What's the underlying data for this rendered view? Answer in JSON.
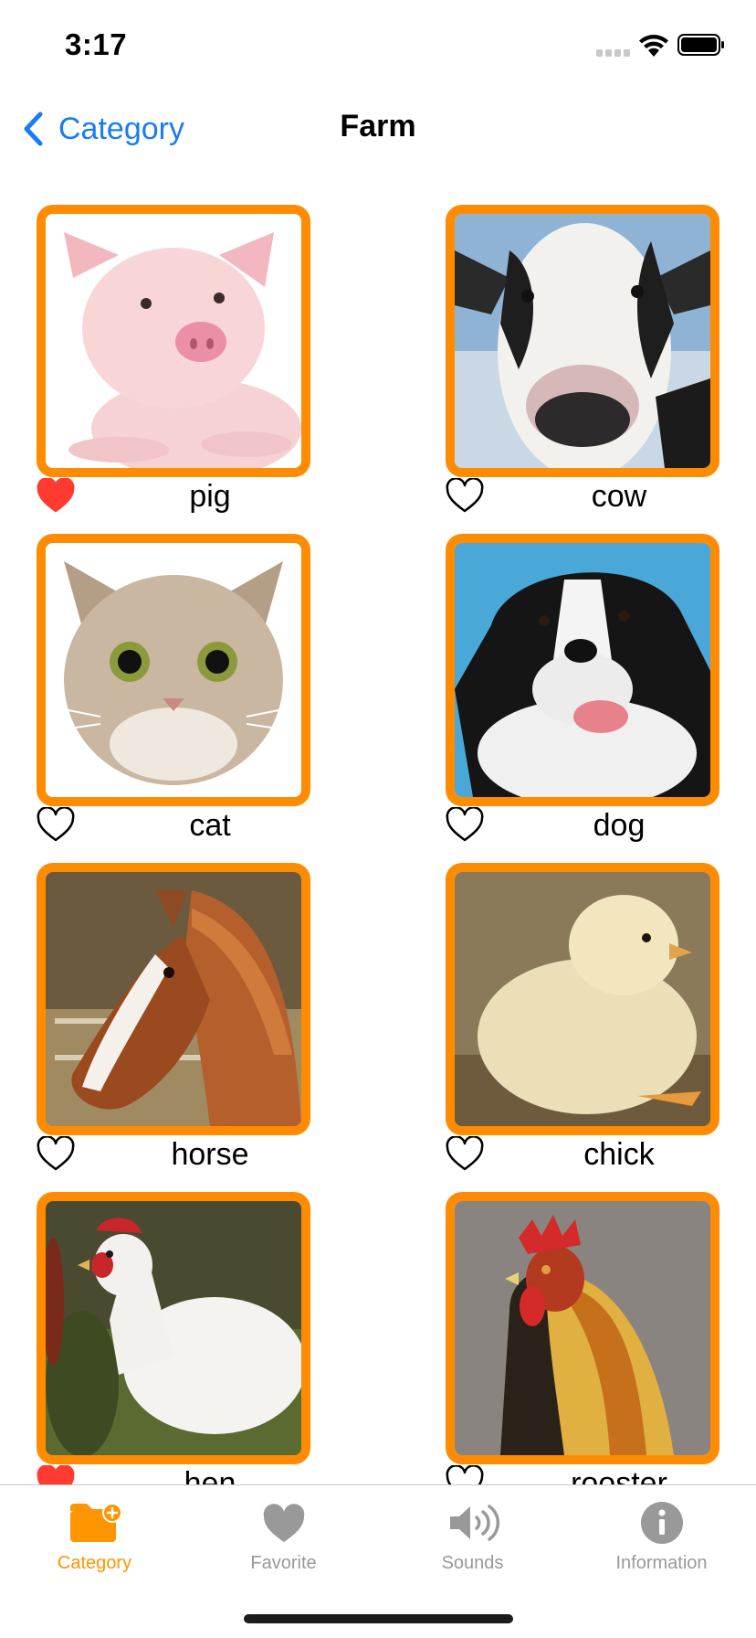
{
  "status_bar": {
    "time": "3:17"
  },
  "nav": {
    "back_label": "Category",
    "title": "Farm"
  },
  "animals": [
    {
      "name": "pig",
      "favorite": true
    },
    {
      "name": "cow",
      "favorite": false
    },
    {
      "name": "cat",
      "favorite": false
    },
    {
      "name": "dog",
      "favorite": false
    },
    {
      "name": "horse",
      "favorite": false
    },
    {
      "name": "chick",
      "favorite": false
    },
    {
      "name": "hen",
      "favorite": true
    },
    {
      "name": "rooster",
      "favorite": false
    }
  ],
  "tabs": [
    {
      "label": "Category",
      "icon": "folder-plus-icon",
      "active": true
    },
    {
      "label": "Favorite",
      "icon": "heart-icon",
      "active": false
    },
    {
      "label": "Sounds",
      "icon": "speaker-icon",
      "active": false
    },
    {
      "label": "Information",
      "icon": "info-icon",
      "active": false
    }
  ],
  "colors": {
    "accent": "#ff8c00",
    "tab_active": "#ff9500",
    "tab_inactive": "#999999",
    "link": "#1a7cf5",
    "favorite_heart": "#ff3b30"
  }
}
